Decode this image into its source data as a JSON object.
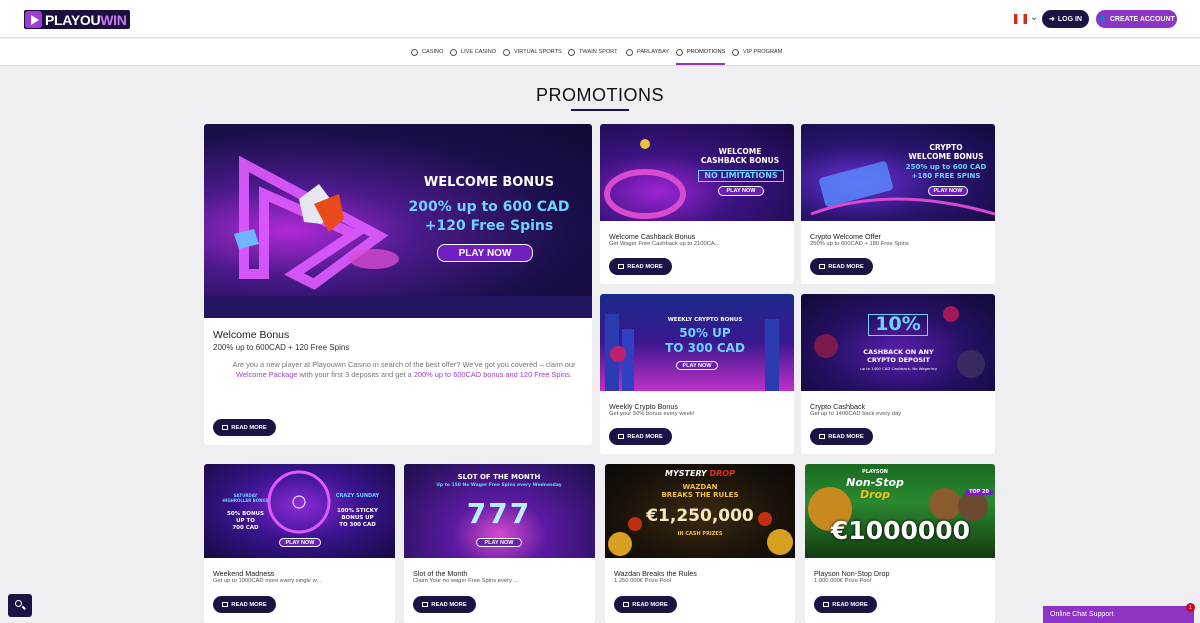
{
  "header": {
    "logo_part1": "PLAYOU",
    "logo_part2": "WIN",
    "login_label": "LOG IN",
    "create_label": "CREATE ACCOUNT"
  },
  "nav": {
    "items": [
      {
        "label": "CASINO",
        "icon": "casino-icon"
      },
      {
        "label": "LIVE CASINO",
        "icon": "live-casino-icon"
      },
      {
        "label": "VIRTUAL SPORTS",
        "icon": "virtual-sports-icon"
      },
      {
        "label": "TWAIN SPORT",
        "icon": "twain-sport-icon"
      },
      {
        "label": "PARLAYBAY",
        "icon": "parlaybay-icon"
      },
      {
        "label": "PROMOTIONS",
        "icon": "promotions-icon"
      },
      {
        "label": "VIP PROGRAM",
        "icon": "vip-icon"
      }
    ],
    "active": "PROMOTIONS"
  },
  "page": {
    "title": "PROMOTIONS"
  },
  "featured": {
    "banner_title": "WELCOME BONUS",
    "banner_line1": "200% up to 600 CAD",
    "banner_line2": "+120 Free Spins",
    "banner_cta": "PLAY NOW",
    "title": "Welcome Bonus",
    "subtitle": "200% up to 600CAD + 120 Free Spins",
    "desc_1": "Are you a new player at Playouwin Casino in search of the best offer? We've got you covered",
    "desc_2": "– claim our ",
    "desc_link1": "Welcome Package",
    "desc_3": " with your first 3 deposits and get a ",
    "desc_link2": "200% up to 600CAD bonus",
    "desc_link3": "and 120 Free Spins",
    "desc_4": ".",
    "read_more": "READ MORE"
  },
  "cards": [
    {
      "banner_l1": "WELCOME",
      "banner_l2": "CASHBACK BONUS",
      "banner_l3": "NO LIMITATIONS",
      "cta": "PLAY NOW",
      "title": "Welcome Cashback Bonus",
      "subtitle": "Get Wager Free Cashback up to 2100CA...",
      "read_more": "READ MORE"
    },
    {
      "banner_l1": "CRYPTO",
      "banner_l2": "WELCOME BONUS",
      "banner_l3": "250% up to 600 CAD",
      "banner_l4": "+180 FREE SPINS",
      "cta": "PLAY NOW",
      "title": "Crypto Welcome Offer",
      "subtitle": "250% up to 600CAD + 180 Free Spins",
      "read_more": "READ MORE"
    },
    {
      "banner_l1": "WEEKLY CRYPTO BONUS",
      "banner_l2": "50% UP",
      "banner_l3": "TO 300 CAD",
      "cta": "PLAY NOW",
      "title": "Weekly Crypto Bonus",
      "subtitle": "Get your 50% bonus every week!",
      "read_more": "READ MORE"
    },
    {
      "banner_l1": "10%",
      "banner_l2": "CASHBACK ON ANY",
      "banner_l3": "CRYPTO DEPOSIT",
      "banner_l4": "up to 1400 CAD Cashback, No Wagering",
      "title": "Crypto Cashback",
      "subtitle": "Get up to 1400CAD back every day",
      "read_more": "READ MORE"
    },
    {
      "banner_a1": "SATURDAY",
      "banner_a2": "HIGHROLLER BONUS",
      "banner_a3": "50% BONUS",
      "banner_a4": "UP TO",
      "banner_a5": "700 CAD",
      "banner_b1": "CRAZY SUNDAY",
      "banner_b2": "100% STICKY",
      "banner_b3": "BONUS UP",
      "banner_b4": "TO 300 CAD",
      "cta": "PLAY NOW",
      "title": "Weekend Madness",
      "subtitle": "Get up to 1000CAD more every single w...",
      "read_more": "READ MORE"
    },
    {
      "banner_l1": "SLOT OF THE MONTH",
      "banner_l2": "Up to 150 No Wager Free Spins every Wednesday",
      "banner_l3": "777",
      "cta": "PLAY NOW",
      "title": "Slot of the Month",
      "subtitle": "Claim Your no wager Free Spins every ...",
      "read_more": "READ MORE"
    },
    {
      "banner_l1": "MYSTERY",
      "banner_l1b": "DROP",
      "banner_l2": "WAZDAN",
      "banner_l3": "BREAKS THE RULES",
      "banner_l4": "€1,250,000",
      "banner_l5": "IN CASH PRIZES",
      "title": "Wazdan Breaks the Rules",
      "subtitle": "1.250.000€ Prize Pool",
      "read_more": "READ MORE"
    },
    {
      "banner_l0": "PLAYSON",
      "banner_l1": "Non-Stop",
      "banner_l2": "Drop",
      "banner_l3": "€1000000",
      "banner_l4": "TOP 20",
      "title": "Playson Non-Stop Drop",
      "subtitle": "1.000.000€ Prize Pool",
      "read_more": "READ MORE"
    }
  ],
  "chat": {
    "label": "Online Chat Support",
    "badge": "1"
  },
  "colors": {
    "navy": "#1a1444",
    "purple": "#8e34c4",
    "background": "#efeff1"
  }
}
